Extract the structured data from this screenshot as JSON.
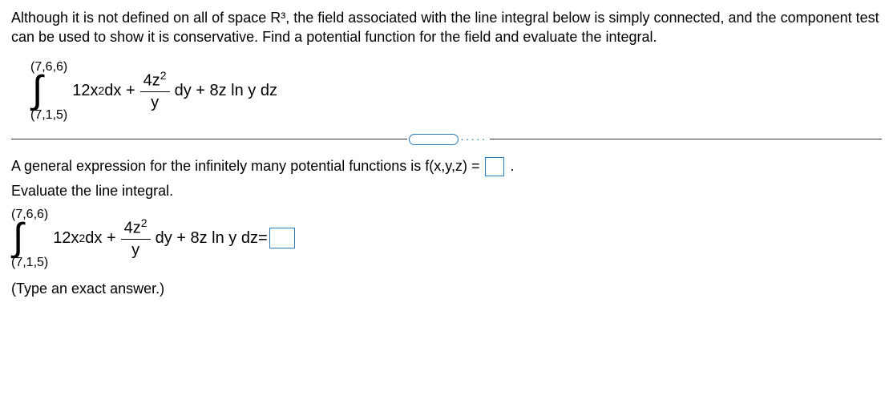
{
  "problem": {
    "text": "Although it is not defined on all of space R³, the field associated with the line integral below is simply connected, and the component test can be used to show it is conservative. Find a potential function for the field and evaluate the integral."
  },
  "integral": {
    "upper_limit": "(7,6,6)",
    "lower_limit": "(7,1,5)",
    "term1_coef": "12x",
    "term1_exp": "2",
    "term1_diff": " dx + ",
    "frac_num_coef": "4z",
    "frac_num_exp": "2",
    "frac_den": "y",
    "after_frac": " dy + 8z ln y dz"
  },
  "q1": {
    "prompt_before": "A general expression for the infinitely many potential functions is f(x,y,z) = ",
    "prompt_after": "."
  },
  "q2": {
    "heading": "Evaluate the line integral.",
    "equals": " = ",
    "hint": "(Type an exact answer.)"
  }
}
